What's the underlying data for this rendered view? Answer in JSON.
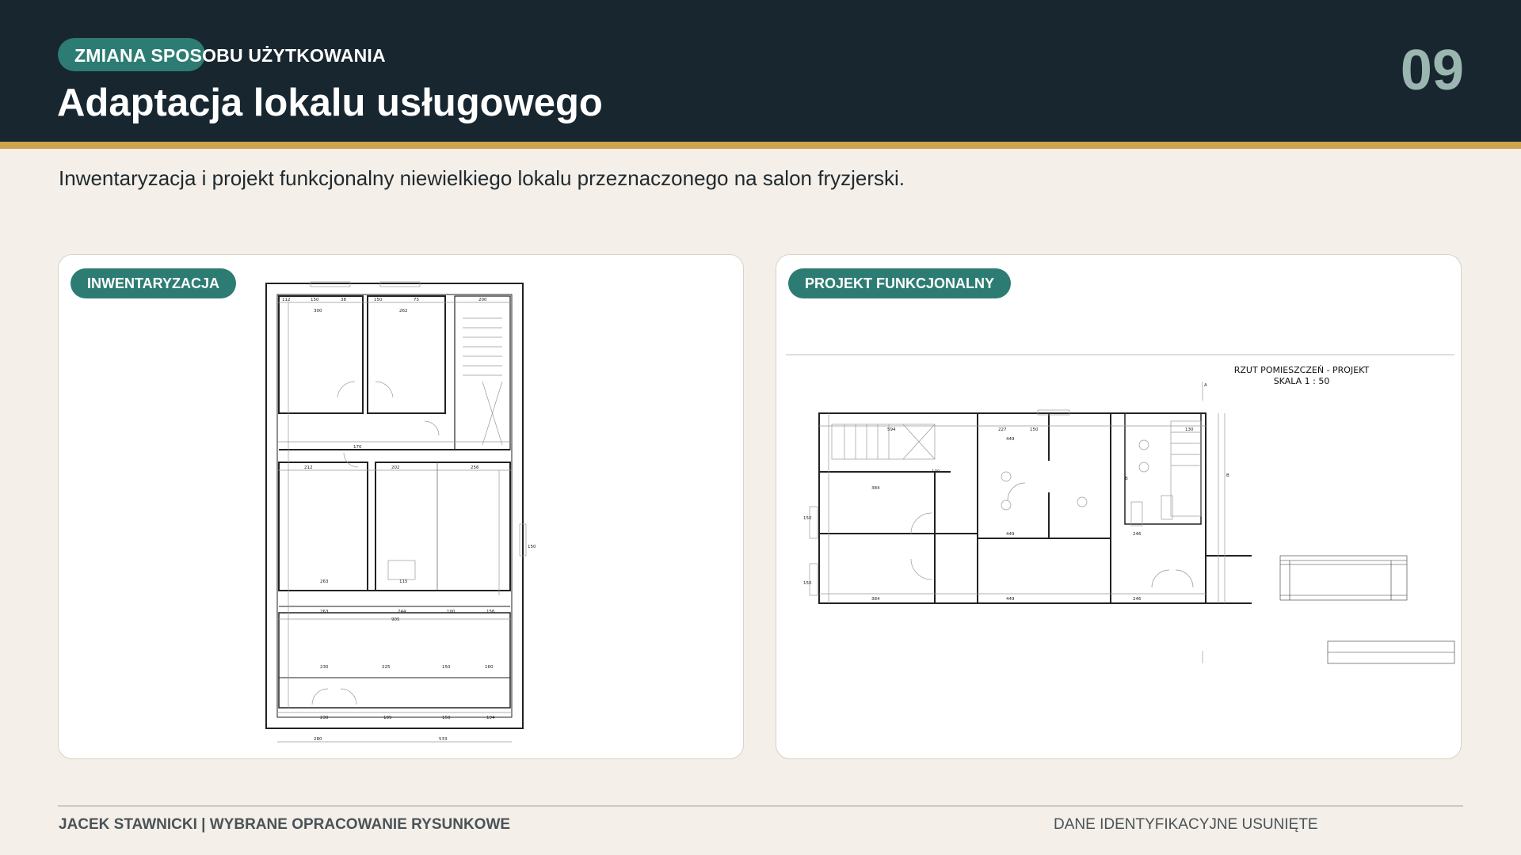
{
  "header": {
    "kicker": "ZMIANA SPOSOBU UŻYTKOWANIA",
    "title": "Adaptacja lokalu usługowego",
    "page_number": "09"
  },
  "subtitle": "Inwentaryzacja i projekt funkcjonalny niewielkiego lokalu przeznaczonego na salon fryzjerski.",
  "panels": [
    {
      "label": "INWENTARYZACJA"
    },
    {
      "label": "PROJEKT FUNKCJONALNY",
      "drawing_title": "RZUT POMIESZCZEŃ - PROJEKT",
      "drawing_scale": "SKALA 1 : 50"
    }
  ],
  "footer": {
    "left": "JACEK STAWNICKI  |  WYBRANE OPRACOWANIE RYSUNKOWE",
    "right": "DANE IDENTYFIKACYJNE USUNIĘTE"
  },
  "colors": {
    "header_bg": "#17262f",
    "accent_stripe": "#cfa34c",
    "pill": "#2d7c73",
    "page_number": "#9bb5b0",
    "background": "#f4efe8"
  }
}
